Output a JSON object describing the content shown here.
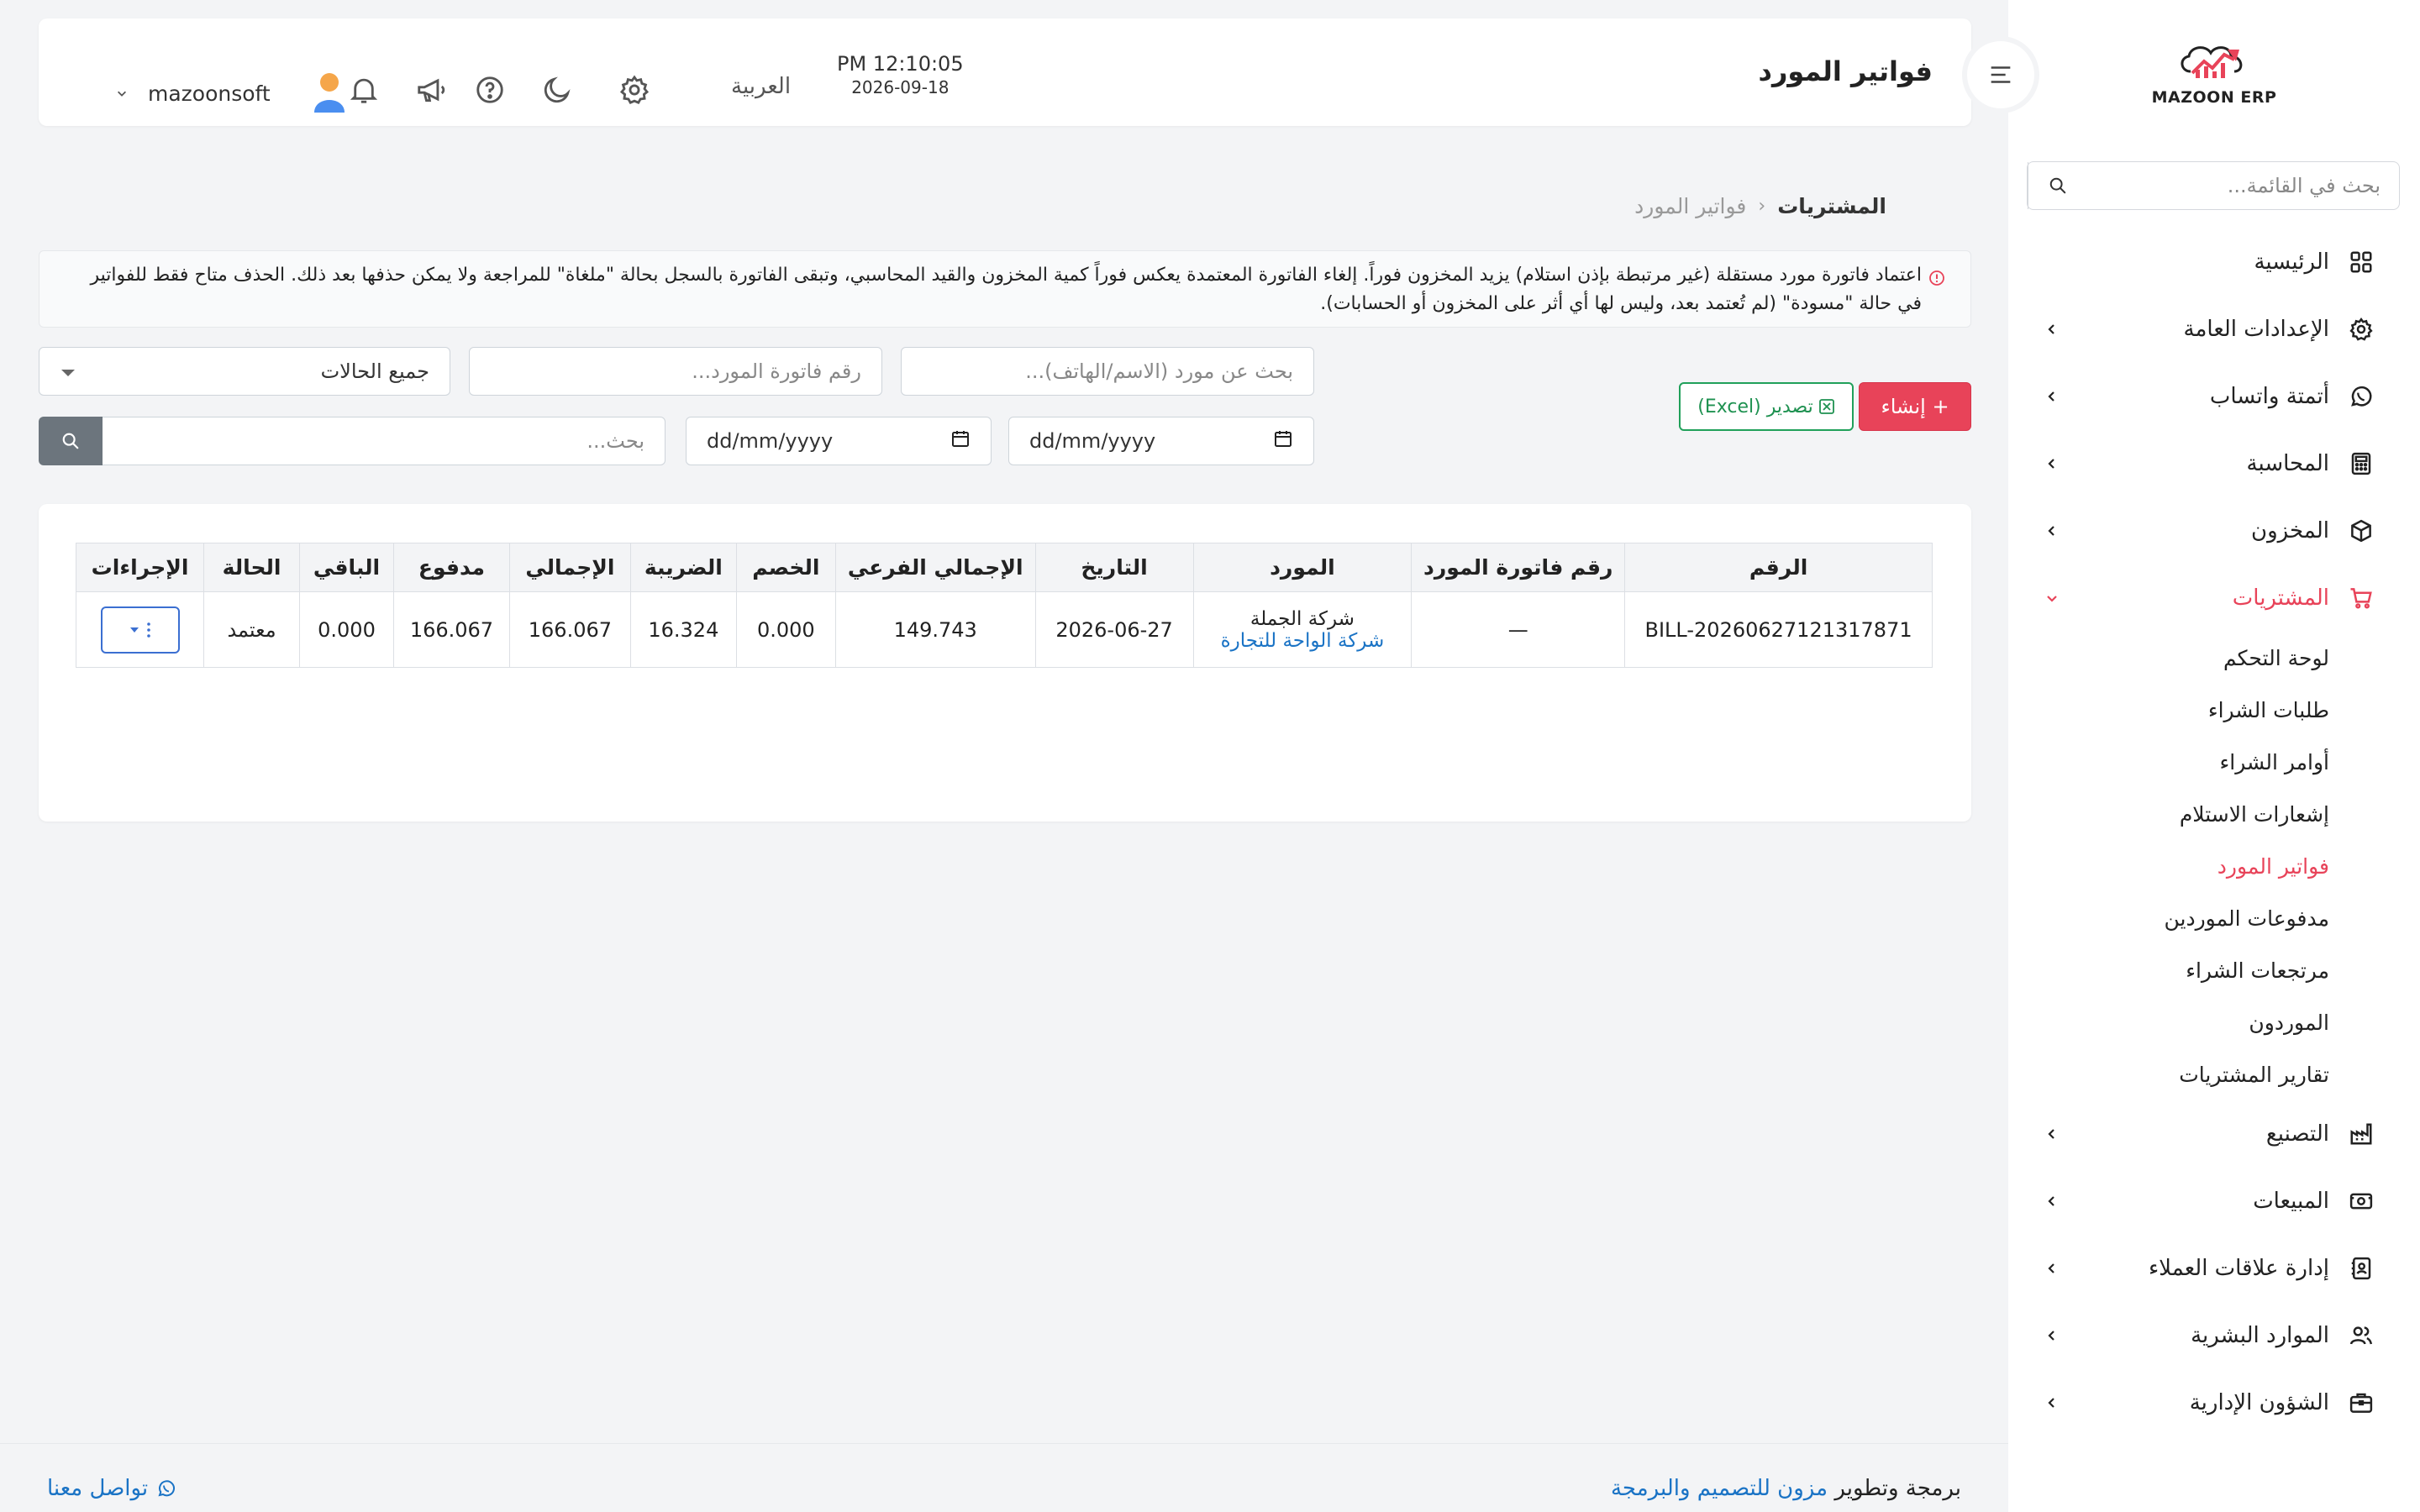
{
  "brand": {
    "logo_text": "MAZOON ERP",
    "logo_tag": "ERP ERP"
  },
  "colors": {
    "accent": "#e84359",
    "link": "#1a73c5",
    "export_green": "#20a05a"
  },
  "sidebar": {
    "search_placeholder": "بحث في القائمة...",
    "items": [
      {
        "label": "الرئيسية",
        "icon": "grid-icon",
        "has_children": false
      },
      {
        "label": "الإعدادات العامة",
        "icon": "gear-icon",
        "has_children": true
      },
      {
        "label": "أتمتة واتساب",
        "icon": "whatsapp-icon",
        "has_children": true
      },
      {
        "label": "المحاسبة",
        "icon": "calculator-icon",
        "has_children": true
      },
      {
        "label": "المخزون",
        "icon": "box-icon",
        "has_children": true
      },
      {
        "label": "المشتريات",
        "icon": "cart-icon",
        "has_children": true,
        "expanded": true,
        "active": true
      },
      {
        "label": "التصنيع",
        "icon": "factory-icon",
        "has_children": true
      },
      {
        "label": "المبيعات",
        "icon": "money-icon",
        "has_children": true
      },
      {
        "label": "إدارة علاقات العملاء",
        "icon": "address-book-icon",
        "has_children": true
      },
      {
        "label": "الموارد البشرية",
        "icon": "users-icon",
        "has_children": true
      },
      {
        "label": "الشؤون الإدارية",
        "icon": "briefcase-icon",
        "has_children": true
      }
    ],
    "purchases_sub": [
      {
        "label": "لوحة التحكم"
      },
      {
        "label": "طلبات الشراء"
      },
      {
        "label": "أوامر الشراء"
      },
      {
        "label": "إشعارات الاستلام"
      },
      {
        "label": "فواتير المورد",
        "active": true
      },
      {
        "label": "مدفوعات الموردين"
      },
      {
        "label": "مرتجعات الشراء"
      },
      {
        "label": "الموردون"
      },
      {
        "label": "تقارير المشتريات"
      }
    ]
  },
  "header": {
    "title": "فواتير المورد",
    "time": "PM 12:10:05",
    "date": "2026-09-18",
    "language": "العربية",
    "username": "mazoonsoft"
  },
  "breadcrumb": {
    "parent": "المشتريات",
    "current": "فواتير المورد"
  },
  "alert": {
    "text": "اعتماد فاتورة مورد مستقلة (غير مرتبطة بإذن استلام) يزيد المخزون فوراً. إلغاء الفاتورة المعتمدة يعكس فوراً كمية المخزون والقيد المحاسبي، وتبقى الفاتورة بالسجل بحالة \"ملغاة\" للمراجعة ولا يمكن حذفها بعد ذلك. الحذف متاح فقط للفواتير في حالة \"مسودة\" (لم تُعتمد بعد، وليس لها أي أثر على المخزون أو الحسابات)."
  },
  "filters": {
    "supplier_search_placeholder": "بحث عن مورد (الاسم/الهاتف)...",
    "invoice_no_placeholder": "رقم فاتورة المورد...",
    "status_selected": "جميع الحالات",
    "date_from": "dd/mm/yyyy",
    "date_to": "dd/mm/yyyy",
    "search_placeholder": "بحث..."
  },
  "actions": {
    "create_label": "+ إنشاء",
    "export_label": "تصدير (Excel)"
  },
  "table": {
    "columns": [
      "الرقم",
      "رقم فاتورة المورد",
      "المورد",
      "التاريخ",
      "الإجمالي الفرعي",
      "الخصم",
      "الضريبة",
      "الإجمالي",
      "مدفوع",
      "الباقي",
      "الحالة",
      "الإجراءات"
    ],
    "rows": [
      {
        "number": "BILL-20260627121317871",
        "supplier_invoice_no": "—",
        "supplier_name": "شركة الجملة",
        "supplier_company": "شركة الواحة للتجارة",
        "date": "2026-06-27",
        "subtotal": "149.743",
        "discount": "0.000",
        "tax": "16.324",
        "total": "166.067",
        "paid": "166.067",
        "remaining": "0.000",
        "status": "معتمد"
      }
    ]
  },
  "footer": {
    "credit_prefix": "برمجة وتطوير",
    "credit_link": "مزون للتصميم والبرمجة",
    "contact": "تواصل معنا"
  }
}
